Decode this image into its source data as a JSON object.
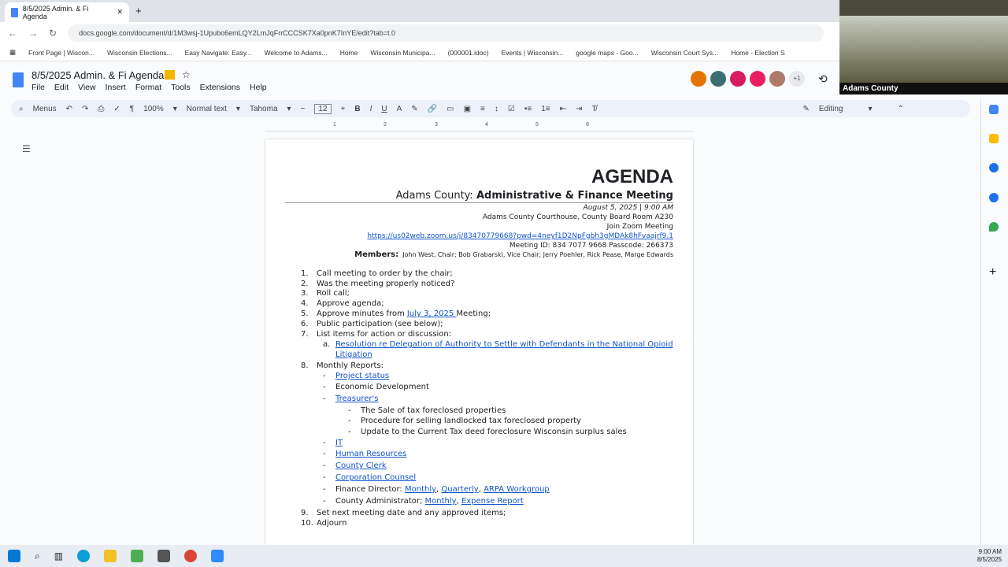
{
  "browser": {
    "tab_title": "8/5/2025 Admin. & Fi Agenda",
    "url": "docs.google.com/document/d/1M3wsj-1Upubo6emLQY2LmJqFrrCCCSK7Xa0pnK7InYE/edit?tab=t.0",
    "bookmarks": [
      "Front Page | Wiscon...",
      "Wisconsin Elections...",
      "Easy Navigate: Easy...",
      "Welcome to Adams...",
      "Home",
      "Wisconsin Municipa...",
      "(000001.idoc)",
      "Events | Wisconsin...",
      "google maps - Goo...",
      "Wisconsin Court Sys...",
      "Home - Election S"
    ]
  },
  "docs": {
    "title": "8/5/2025 Admin. & Fi Agenda",
    "menus": [
      "File",
      "Edit",
      "View",
      "Insert",
      "Format",
      "Tools",
      "Extensions",
      "Help"
    ],
    "toolbar": {
      "menus": "Menus",
      "zoom": "100%",
      "style": "Normal text",
      "font": "Tahoma",
      "size": "12",
      "mode": "Editing"
    },
    "avatar_extra": "+1",
    "ruler": [
      "1",
      "2",
      "3",
      "4",
      "5",
      "6"
    ]
  },
  "video": {
    "label": "Adams County"
  },
  "doc": {
    "heading": "AGENDA",
    "county": "Adams County:",
    "meeting": "Administrative & Finance Meeting",
    "date": "August 5, 2025 |  9:00 AM",
    "location": "Adams County Courthouse, County Board Room A230",
    "join": "Join Zoom Meeting",
    "zoom_link": "https://us02web.zoom.us/j/83470779668?pwd=4neyf1D2NpFgbh3gMDAk8hFvaajrf9.1",
    "meeting_id": "Meeting ID: 834 7077 9668 Passcode: 266373",
    "members_label": "Members:",
    "members": "John West, Chair; Bob Grabarski, Vice Chair; Jerry Poehler, Rick Pease, Marge Edwards",
    "items": [
      {
        "n": "1.",
        "t": "Call meeting to order by the chair;"
      },
      {
        "n": "2.",
        "t": "Was the meeting properly noticed?"
      },
      {
        "n": "3.",
        "t": "Roll call;"
      },
      {
        "n": "4.",
        "t": "Approve agenda;"
      },
      {
        "n": "5.",
        "pre": "Approve minutes from ",
        "link": "July 3, 2025 ",
        "post": "Meeting;"
      },
      {
        "n": "6.",
        "t": "Public participation (see below);"
      },
      {
        "n": "7.",
        "t": "List items for action or discussion:"
      },
      {
        "n": "a.",
        "link": "Resolution re Delegation of Authority to Settle with Defendants in the National Opioid",
        "link2": "Litigation"
      },
      {
        "n": "8.",
        "t": "Monthly Reports:"
      },
      {
        "n": "-",
        "link": "Project status"
      },
      {
        "n": "-",
        "t": "Economic Development"
      },
      {
        "n": "-",
        "link": "Treasurer's"
      },
      {
        "n": "-",
        "t": "The Sale of tax foreclosed properties"
      },
      {
        "n": "-",
        "t": "Procedure for selling landlocked tax foreclosed property"
      },
      {
        "n": "-",
        "t": "Update to the Current Tax deed foreclosure Wisconsin surplus sales"
      },
      {
        "n": "-",
        "link": "IT"
      },
      {
        "n": "-",
        "link": "Human Resources"
      },
      {
        "n": "-",
        "link": "County Clerk"
      },
      {
        "n": "-",
        "link": "Corporation Counsel"
      },
      {
        "n": "-",
        "pre": "Finance Director: ",
        "link": "Monthly",
        "sep": ", ",
        "link2": "Quarterly",
        "sep2": ", ",
        "link3": "ARPA Workgroup"
      },
      {
        "n": "-",
        "pre": "County Administrator; ",
        "link": "Monthly",
        "sep": ", ",
        "link2": "Expense Report"
      },
      {
        "n": "9.",
        "t": "Set next meeting date and any approved items;"
      },
      {
        "n": "10.",
        "t": "Adjourn"
      }
    ]
  },
  "taskbar": {
    "time": "9:00 AM",
    "date": "8/5/2025"
  }
}
